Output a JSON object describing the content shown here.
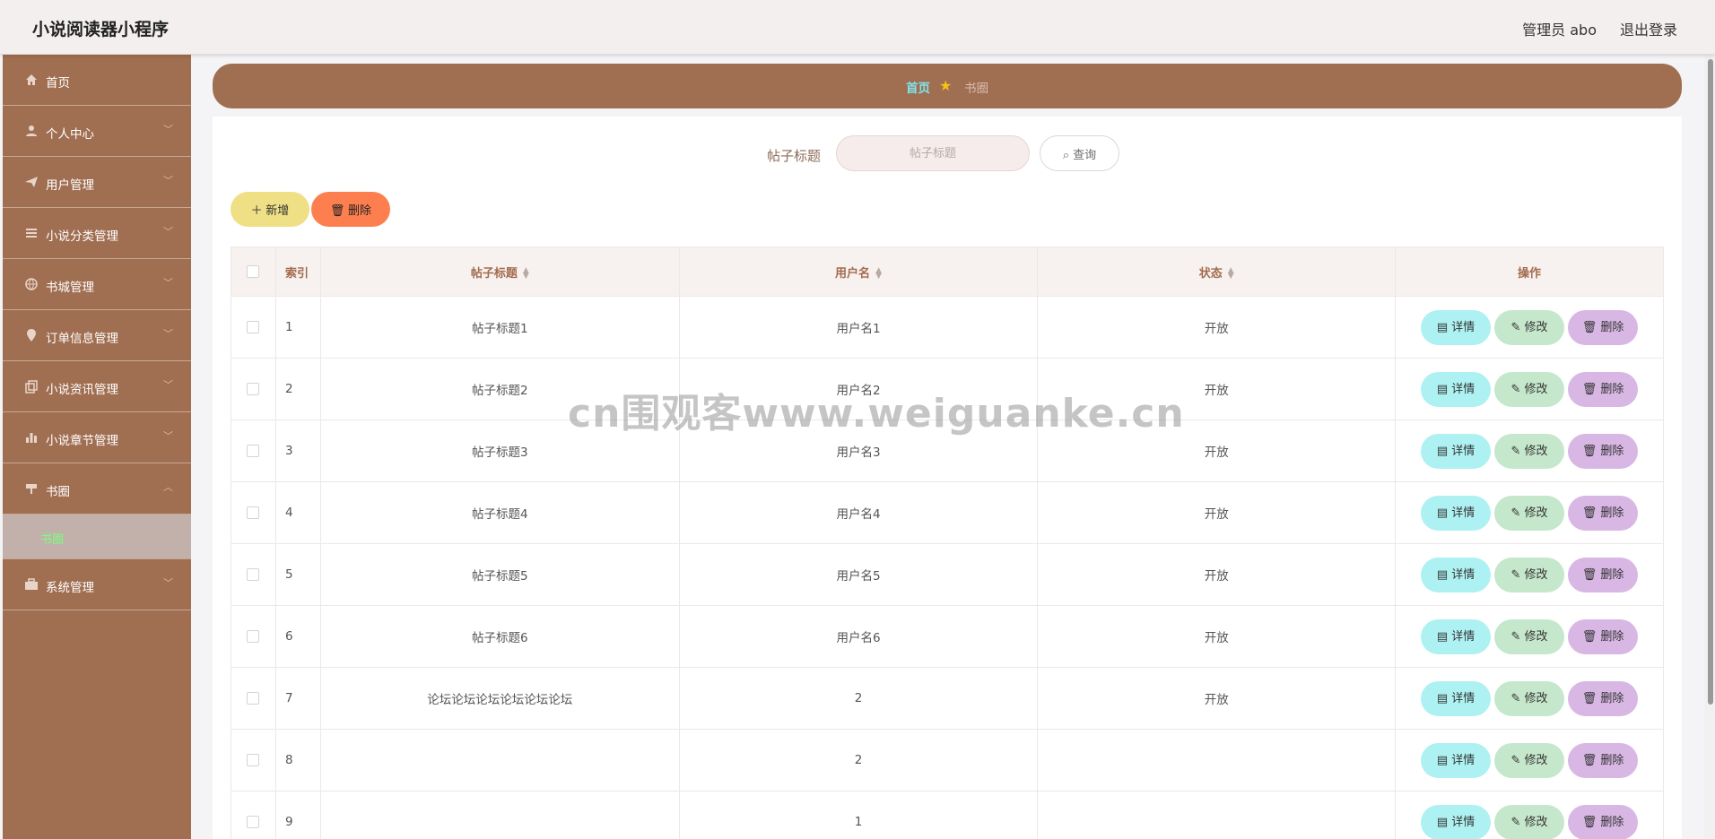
{
  "header": {
    "title": "小说阅读器小程序",
    "admin": "管理员 abo",
    "logout": "退出登录"
  },
  "sidebar": {
    "items": [
      {
        "label": "首页",
        "icon": "home-icon"
      },
      {
        "label": "个人中心",
        "icon": "user-icon"
      },
      {
        "label": "用户管理",
        "icon": "send-icon"
      },
      {
        "label": "小说分类管理",
        "icon": "list-icon"
      },
      {
        "label": "书城管理",
        "icon": "globe-icon"
      },
      {
        "label": "订单信息管理",
        "icon": "pin-icon"
      },
      {
        "label": "小说资讯管理",
        "icon": "copy-icon"
      },
      {
        "label": "小说章节管理",
        "icon": "bar-chart-icon"
      },
      {
        "label": "书圈",
        "icon": "brush-icon",
        "sub": "书圈"
      },
      {
        "label": "系统管理",
        "icon": "briefcase-icon"
      }
    ]
  },
  "breadcrumb": {
    "home": "首页",
    "current": "书圈"
  },
  "search": {
    "label": "帖子标题",
    "placeholder": "帖子标题",
    "button": "查询"
  },
  "actions": {
    "add": "新增",
    "delete": "删除"
  },
  "table": {
    "headers": {
      "index": "索引",
      "title": "帖子标题",
      "username": "用户名",
      "status": "状态",
      "ops": "操作"
    },
    "row_actions": {
      "detail": "详情",
      "edit": "修改",
      "delete": "删除"
    },
    "rows": [
      {
        "index": "1",
        "title": "帖子标题1",
        "username": "用户名1",
        "status": "开放"
      },
      {
        "index": "2",
        "title": "帖子标题2",
        "username": "用户名2",
        "status": "开放"
      },
      {
        "index": "3",
        "title": "帖子标题3",
        "username": "用户名3",
        "status": "开放"
      },
      {
        "index": "4",
        "title": "帖子标题4",
        "username": "用户名4",
        "status": "开放"
      },
      {
        "index": "5",
        "title": "帖子标题5",
        "username": "用户名5",
        "status": "开放"
      },
      {
        "index": "6",
        "title": "帖子标题6",
        "username": "用户名6",
        "status": "开放"
      },
      {
        "index": "7",
        "title": "论坛论坛论坛论坛论坛论坛",
        "username": "2",
        "status": "开放"
      },
      {
        "index": "8",
        "title": "",
        "username": "2",
        "status": ""
      },
      {
        "index": "9",
        "title": "",
        "username": "1",
        "status": ""
      }
    ]
  },
  "watermark": "cn围观客www.weiguanke.cn",
  "colors": {
    "sidebar": "#a06e51",
    "accent_header": "#a36b4e",
    "add": "#efdf85",
    "delete": "#fd7f4f",
    "detail": "#aef1f2",
    "edit": "#c5e7cc",
    "row_delete": "#d8b7e4"
  }
}
